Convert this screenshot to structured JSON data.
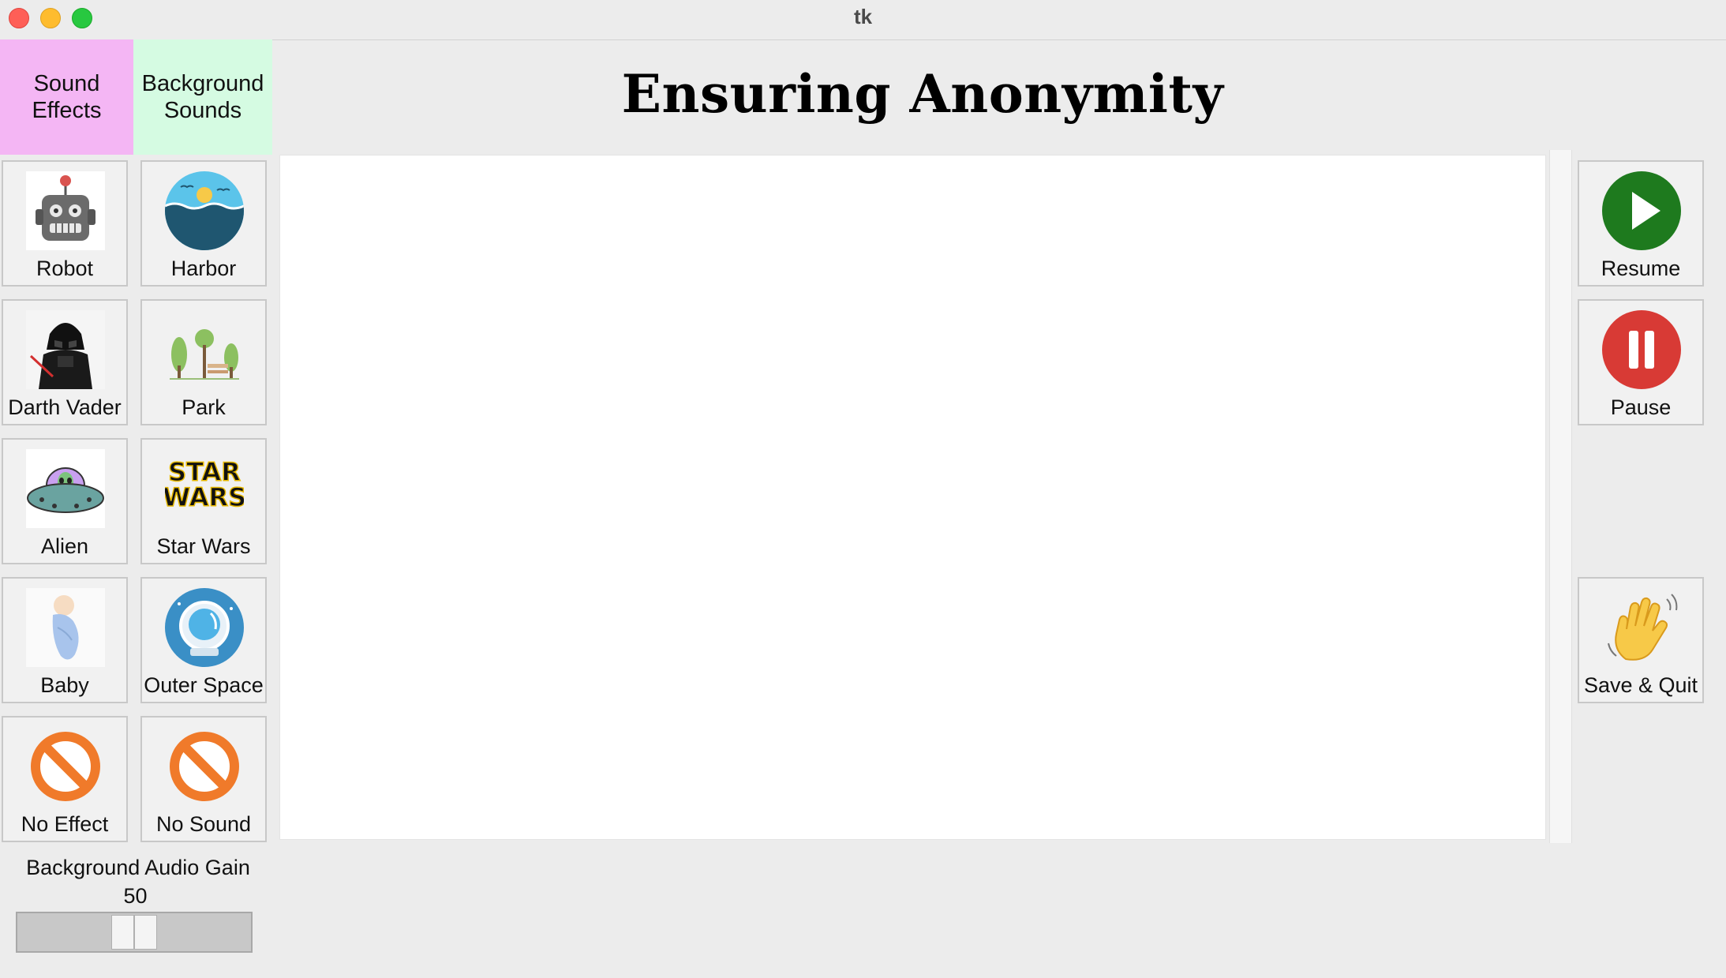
{
  "window": {
    "title": "tk"
  },
  "tabs": {
    "sound_effects": "Sound\nEffects",
    "background_sounds": "Background\nSounds"
  },
  "heading": "Ensuring Anonymity",
  "sound_effects": [
    {
      "label": "Robot",
      "icon": "robot-icon"
    },
    {
      "label": "Darth Vader",
      "icon": "darth-vader-icon"
    },
    {
      "label": "Alien",
      "icon": "alien-ufo-icon"
    },
    {
      "label": "Baby",
      "icon": "baby-icon"
    },
    {
      "label": "No Effect",
      "icon": "no-entry-icon"
    }
  ],
  "background_sounds": [
    {
      "label": "Harbor",
      "icon": "harbor-icon"
    },
    {
      "label": "Park",
      "icon": "park-icon"
    },
    {
      "label": "Star Wars",
      "icon": "star-wars-logo-icon"
    },
    {
      "label": "Outer Space",
      "icon": "astronaut-helmet-icon"
    },
    {
      "label": "No Sound",
      "icon": "no-entry-icon"
    }
  ],
  "logo_text": "STAR\nWARS",
  "controls": {
    "resume": "Resume",
    "pause": "Pause",
    "save_quit": "Save & Quit"
  },
  "gain": {
    "label": "Background Audio Gain",
    "value": "50",
    "min": 0,
    "max": 100
  },
  "colors": {
    "sound_effects_tab": "#f4b6f4",
    "background_tab": "#d5fbe2",
    "resume_green": "#1e7a1e",
    "pause_red": "#d83a35",
    "no_entry_orange": "#f07a2a"
  }
}
